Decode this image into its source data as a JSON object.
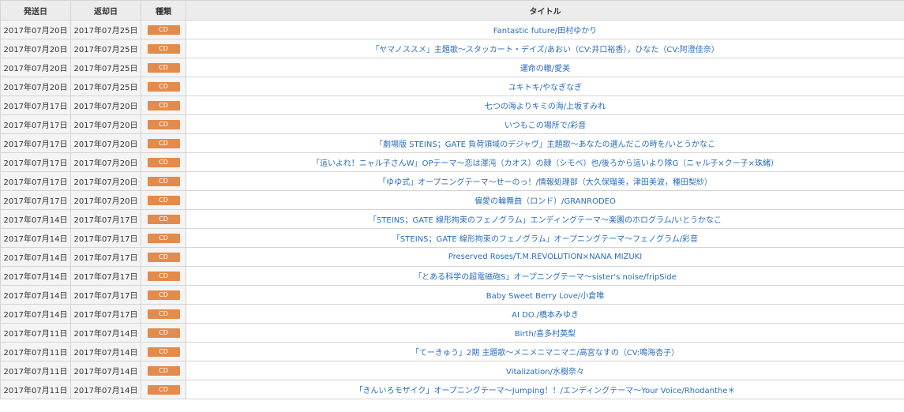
{
  "colors": {
    "header_bg": "#ececec",
    "date_cell_bg": "#f4f4f4",
    "badge_bg": "#e38b4c",
    "link": "#2a6dbd",
    "border": "#d4d4d4"
  },
  "table": {
    "headers": {
      "ship_date": "発送日",
      "return_date": "返却日",
      "kind": "種類",
      "title": "タイトル"
    },
    "rows": [
      {
        "ship": "2017年07月20日",
        "ret": "2017年07月25日",
        "kind": "CD",
        "title": "Fantastic future/田村ゆかり"
      },
      {
        "ship": "2017年07月20日",
        "ret": "2017年07月25日",
        "kind": "CD",
        "title": "「ヤマノススメ」主題歌～スタッカート・デイズ/あおい（CV:井口裕香），ひなた（CV:阿澄佳奈）"
      },
      {
        "ship": "2017年07月20日",
        "ret": "2017年07月25日",
        "kind": "CD",
        "title": "運命の轍/愛美"
      },
      {
        "ship": "2017年07月20日",
        "ret": "2017年07月25日",
        "kind": "CD",
        "title": "ユキトキ/やなぎなぎ"
      },
      {
        "ship": "2017年07月17日",
        "ret": "2017年07月20日",
        "kind": "CD",
        "title": "七つの海よりキミの海/上坂すみれ"
      },
      {
        "ship": "2017年07月17日",
        "ret": "2017年07月20日",
        "kind": "CD",
        "title": "いつもこの場所で/彩音"
      },
      {
        "ship": "2017年07月17日",
        "ret": "2017年07月20日",
        "kind": "CD",
        "title": "「劇場版 STEINS；GATE 負荷領域のデジャヴ」主題歌～あなたの選んだこの時を/いとうかなこ"
      },
      {
        "ship": "2017年07月17日",
        "ret": "2017年07月20日",
        "kind": "CD",
        "title": "「這いよれ！ニャル子さんW」OPテーマ～恋は渾沌（カオス）の隷（シモベ）也/後ろから這いより隊G（ニャル子×クー子×珠緒）"
      },
      {
        "ship": "2017年07月17日",
        "ret": "2017年07月20日",
        "kind": "CD",
        "title": "「ゆゆ式」オープニングテーマ～せーのっ！/情報処理部（大久保瑠美，津田美波，種田梨紗）"
      },
      {
        "ship": "2017年07月17日",
        "ret": "2017年07月20日",
        "kind": "CD",
        "title": "偏愛の輪舞曲（ロンド）/GRANRODEO"
      },
      {
        "ship": "2017年07月14日",
        "ret": "2017年07月17日",
        "kind": "CD",
        "title": "「STEINS；GATE 線形拘束のフェノグラム」エンディングテーマ～楽園のホログラム/いとうかなこ"
      },
      {
        "ship": "2017年07月14日",
        "ret": "2017年07月17日",
        "kind": "CD",
        "title": "「STEINS；GATE 線形拘束のフェノグラム」オープニングテーマ～フェノグラム/彩音"
      },
      {
        "ship": "2017年07月14日",
        "ret": "2017年07月17日",
        "kind": "CD",
        "title": "Preserved Roses/T.M.REVOLUTION×NANA MIZUKI"
      },
      {
        "ship": "2017年07月14日",
        "ret": "2017年07月17日",
        "kind": "CD",
        "title": "「とある科学の超電磁砲S」オープニングテーマ～sister's noise/fripSide"
      },
      {
        "ship": "2017年07月14日",
        "ret": "2017年07月17日",
        "kind": "CD",
        "title": "Baby Sweet Berry Love/小倉唯"
      },
      {
        "ship": "2017年07月14日",
        "ret": "2017年07月17日",
        "kind": "CD",
        "title": "AI DO./橋本みゆき"
      },
      {
        "ship": "2017年07月11日",
        "ret": "2017年07月14日",
        "kind": "CD",
        "title": "Birth/喜多村英梨"
      },
      {
        "ship": "2017年07月11日",
        "ret": "2017年07月14日",
        "kind": "CD",
        "title": "「てーきゅう」2期 主題歌～メニメニマニマニ/高宮なすの（CV:鳴海杏子）"
      },
      {
        "ship": "2017年07月11日",
        "ret": "2017年07月14日",
        "kind": "CD",
        "title": "Vitalization/水樹奈々"
      },
      {
        "ship": "2017年07月11日",
        "ret": "2017年07月14日",
        "kind": "CD",
        "title": "「きんいろモザイク」オープニングテーマ～Jumping！！/エンディングテーマ～Your Voice/Rhodanthe＊"
      }
    ]
  }
}
